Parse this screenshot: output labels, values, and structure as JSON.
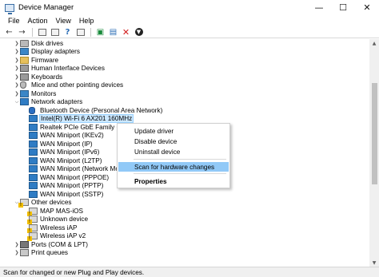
{
  "window": {
    "title": "Device Manager",
    "minimize_glyph": "—",
    "maximize_glyph": "☐",
    "close_glyph": "✕"
  },
  "menu": [
    "File",
    "Action",
    "View",
    "Help"
  ],
  "toolbar": {
    "icons": [
      "back-arrow-icon",
      "forward-arrow-icon",
      "properties-icon",
      "print-icon",
      "help-icon",
      "view-icon",
      "update-driver-icon",
      "scan-hardware-icon",
      "uninstall-icon",
      "enable-icon"
    ]
  },
  "tree": {
    "categories_top": [
      {
        "label": "Disk drives",
        "icon": "disk-icon"
      },
      {
        "label": "Display adapters",
        "icon": "monitor-icon"
      },
      {
        "label": "Firmware",
        "icon": "folder-icon"
      },
      {
        "label": "Human Interface Devices",
        "icon": "hid-icon"
      },
      {
        "label": "Keyboards",
        "icon": "keyboard-icon"
      },
      {
        "label": "Mice and other pointing devices",
        "icon": "mouse-icon"
      },
      {
        "label": "Monitors",
        "icon": "monitor-icon"
      }
    ],
    "network_adapters": {
      "label": "Network adapters",
      "children": [
        "Bluetooth Device (Personal Area Network)",
        "Intel(R) Wi-Fi 6 AX201 160MHz",
        "Realtek PCIe GbE Family Contr",
        "WAN Miniport (IKEv2)",
        "WAN Miniport (IP)",
        "WAN Miniport (IPv6)",
        "WAN Miniport (L2TP)",
        "WAN Miniport (Network Moni",
        "WAN Miniport (PPPOE)",
        "WAN Miniport (PPTP)",
        "WAN Miniport (SSTP)"
      ]
    },
    "other_devices": {
      "label": "Other devices",
      "children": [
        "MAP MAS-iOS",
        "Unknown device",
        "Wireless iAP",
        "Wireless iAP v2"
      ]
    },
    "categories_bottom": [
      {
        "label": "Ports (COM & LPT)",
        "icon": "port-icon"
      },
      {
        "label": "Print queues",
        "icon": "printer-icon"
      }
    ]
  },
  "context_menu": {
    "items": [
      "Update driver",
      "Disable device",
      "Uninstall device",
      "Scan for hardware changes",
      "Properties"
    ],
    "hovered": "Scan for hardware changes"
  },
  "status": "Scan for changed or new Plug and Play devices."
}
